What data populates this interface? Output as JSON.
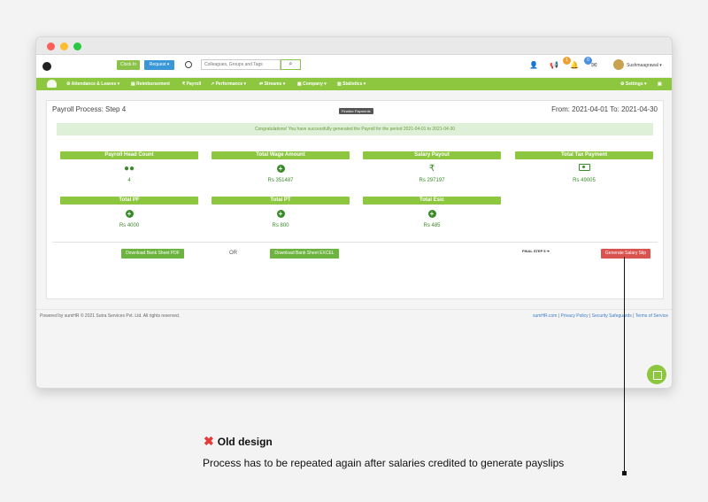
{
  "topbar": {
    "clock_in": "Clock In",
    "request": "Request ▾",
    "search_placeholder": "Colleagues, Groups and Tags",
    "badge1": "1",
    "badge2": "0",
    "username": "Sushmaagrawal ▾"
  },
  "nav": {
    "items": [
      "⚙ Attendance & Leaves ▾",
      "▤ Reimbursement",
      "₹ Payroll",
      "↗ Performance ▾",
      "⇄ Streams ▾",
      "▦ Company ▾",
      "▥ Statistics ▾"
    ],
    "settings": "⚙ Settings ▾"
  },
  "card": {
    "title": "Payroll Process: Step 4",
    "finalize": "Finalize Payments",
    "date_range": "From: 2021-04-01 To: 2021-04-30",
    "alert": "Congratulations! You have successfully generated the Payroll for the period 2021-04-01 to 2021-04-30"
  },
  "stats": [
    {
      "label": "Payroll Head Count",
      "value": "4",
      "icon": "users-icon"
    },
    {
      "label": "Total Wage Amount",
      "value": "Rs 351487",
      "icon": "plus-circle-icon"
    },
    {
      "label": "Salary Payout",
      "value": "Rs 297197",
      "icon": "rupee-icon"
    },
    {
      "label": "Total Tax Payment",
      "value": "Rs 49005",
      "icon": "cash-icon"
    },
    {
      "label": "Total PF",
      "value": "Rs 4000",
      "icon": "plus-circle-icon"
    },
    {
      "label": "Total PT",
      "value": "Rs 800",
      "icon": "plus-circle-icon"
    },
    {
      "label": "Total Esic",
      "value": "Rs 485",
      "icon": "plus-circle-icon"
    }
  ],
  "actions": {
    "pdf": "Download Bank Sheet PDF",
    "or": "OR",
    "excel": "Download Bank Sheet EXCEL",
    "final_step": "FINAL STEP 5 ➔",
    "generate": "Generate Salary Slip"
  },
  "footer": {
    "left": "Powered by sumHR © 2021 Sutra Services Pvt. Ltd. All rights reserved.",
    "links": [
      "sumHR.com",
      "Privacy Policy",
      "Security Safeguards",
      "Terms of Service"
    ]
  },
  "annotation": {
    "heading": "Old design",
    "caption": "Process has to be repeated again after salaries credited to generate payslips"
  },
  "colors": {
    "accent": "#8dc63f",
    "danger": "#d9534f",
    "highlight": "#3a8a2a"
  }
}
